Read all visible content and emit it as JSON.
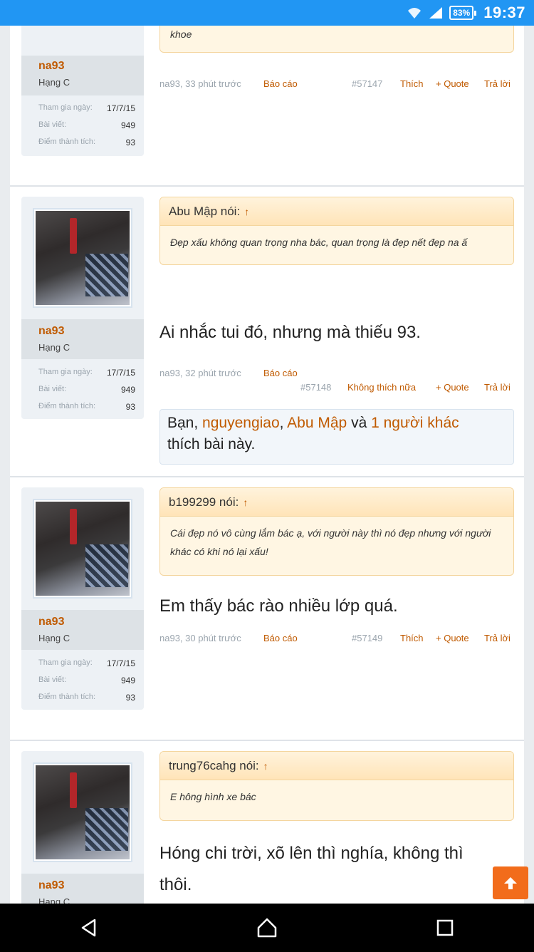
{
  "status_bar": {
    "battery": "83%",
    "time": "19:37",
    "icons": [
      "wifi-icon",
      "signal-icon"
    ]
  },
  "colors": {
    "accent": "#c05a00",
    "quote_bg": "#fff6e3",
    "status_bar": "#2196f3",
    "scroll_button": "#f26c1b"
  },
  "posts": [
    {
      "user": {
        "name": "na93",
        "rank": "Hạng C",
        "joined_label": "Tham gia ngày:",
        "joined": "17/7/15",
        "posts_label": "Bài viết:",
        "posts": "949",
        "points_label": "Điểm thành tích:",
        "points": "93"
      },
      "quote": {
        "body": "khoe"
      },
      "meta": {
        "author_time": "na93, 33 phút trước",
        "report": "Báo cáo",
        "id": "#57147",
        "like": "Thích",
        "quote": "+ Quote",
        "reply": "Trả lời"
      }
    },
    {
      "user": {
        "name": "na93",
        "rank": "Hạng C",
        "joined_label": "Tham gia ngày:",
        "joined": "17/7/15",
        "posts_label": "Bài viết:",
        "posts": "949",
        "points_label": "Điểm thành tích:",
        "points": "93"
      },
      "quote": {
        "author": "Abu Mập nói:",
        "arrow": "↑",
        "body": "Đẹp xấu không quan trọng nha bác, quan trọng là đẹp nết đẹp na ấ"
      },
      "message": "Ai nhắc tui đó, nhưng mà thiếu 93.",
      "meta": {
        "author_time": "na93, 32 phút trước",
        "report": "Báo cáo",
        "id": "#57148",
        "like": "Không thích nữa",
        "quote": "+ Quote",
        "reply": "Trả lời"
      },
      "likes": {
        "prefix": "Bạn, ",
        "user1": "nguyengiao",
        "sep": ", ",
        "user2": "Abu Mập",
        "and": " và ",
        "others": "1 người khác",
        "suffix": "thích bài này."
      }
    },
    {
      "user": {
        "name": "na93",
        "rank": "Hạng C",
        "joined_label": "Tham gia ngày:",
        "joined": "17/7/15",
        "posts_label": "Bài viết:",
        "posts": "949",
        "points_label": "Điểm thành tích:",
        "points": "93"
      },
      "quote": {
        "author": "b199299 nói:",
        "arrow": "↑",
        "body": "Cái đẹp nó vô cùng lắm bác ạ, với người này thì nó đẹp nhưng với người khác có khi nó lại xấu!"
      },
      "message": "Em thấy bác rào nhiều lớp quá.",
      "meta": {
        "author_time": "na93, 30 phút trước",
        "report": "Báo cáo",
        "id": "#57149",
        "like": "Thích",
        "quote": "+ Quote",
        "reply": "Trả lời"
      }
    },
    {
      "user": {
        "name": "na93",
        "rank": "Hạng C"
      },
      "quote": {
        "author": "trung76cahg nói:",
        "arrow": "↑",
        "body": "E hông hình xe bác"
      },
      "message": "Hóng chi trời, xõ lên thì nghía, không thì thôi."
    }
  ]
}
